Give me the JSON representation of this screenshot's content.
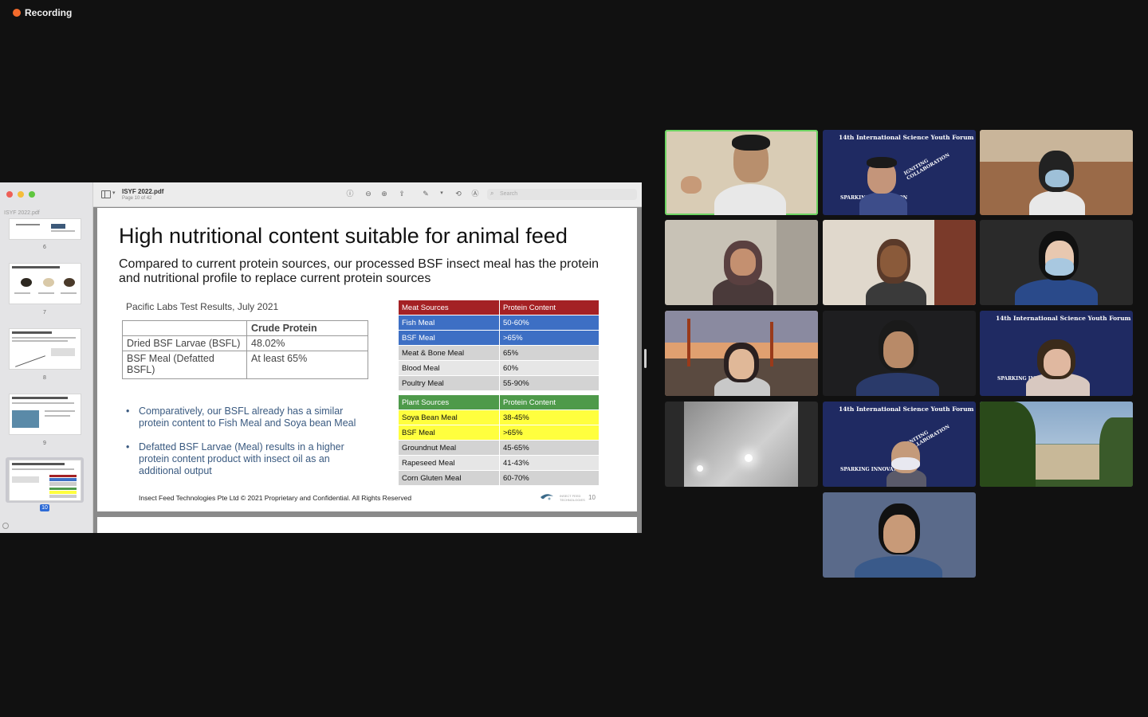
{
  "recording": {
    "label": "Recording"
  },
  "viewer": {
    "sidebar_title": "ISYF 2022.pdf",
    "document_name": "ISYF 2022.pdf",
    "page_indicator": "Page 10 of 42",
    "search_placeholder": "Search",
    "thumbnails": [
      {
        "number": "6",
        "title": ""
      },
      {
        "number": "7",
        "title": "Products and potential applications"
      },
      {
        "number": "8",
        "title": "Market analysis: The timing is right"
      },
      {
        "number": "9",
        "title": "Huge market potential for insect protein in the animal agriculture industry"
      },
      {
        "number": "10",
        "title": "High nutritional content suitable for animal feed",
        "selected": true
      }
    ]
  },
  "slide": {
    "title": "High nutritional content suitable for animal feed",
    "subtitle": "Compared to current protein sources, our processed BSF insect meal has the protein and nutritional profile to replace current protein sources",
    "test_caption": "Pacific Labs Test Results, July 2021",
    "crude_table": {
      "header": [
        "",
        "Crude Protein"
      ],
      "rows": [
        [
          "Dried BSF Larvae (BSFL)",
          "48.02%"
        ],
        [
          "BSF Meal (Defatted BSFL)",
          "At least 65%"
        ]
      ]
    },
    "bullets": [
      "Comparatively, our BSFL already has a similar protein content to Fish Meal and Soya bean Meal",
      "Defatted BSF Larvae (Meal) results in a higher protein content product with insect oil as an additional output"
    ],
    "meat_table": {
      "header": [
        "Meat Sources",
        "Protein Content"
      ],
      "rows": [
        [
          "Fish Meal",
          "50-60%"
        ],
        [
          "BSF Meal",
          ">65%"
        ],
        [
          "Meat & Bone Meal",
          "65%"
        ],
        [
          "Blood Meal",
          "60%"
        ],
        [
          "Poultry Meal",
          "55-90%"
        ]
      ]
    },
    "plant_table": {
      "header": [
        "Plant Sources",
        "Protein Content"
      ],
      "rows": [
        [
          "Soya Bean Meal",
          "38-45%"
        ],
        [
          "BSF Meal",
          ">65%"
        ],
        [
          "Groundnut Meal",
          "45-65%"
        ],
        [
          "Rapeseed Meal",
          "41-43%"
        ],
        [
          "Corn Gluten Meal",
          "60-70%"
        ]
      ]
    },
    "footer": "Insect Feed Technologies Pte Ltd © 2021 Proprietary and Confidential. All Rights Reserved",
    "logo_text": "INSECT FEED TECHNOLOGIES",
    "page_number": "10"
  },
  "participants": {
    "banner_title": "14th International Science Youth Forum",
    "banner_words": [
      "IGNITING COLLABORATION",
      "SPARKING INNOVATION"
    ]
  },
  "colors": {
    "meat_header": "#a42124",
    "plant_header": "#4e9a4a",
    "highlight_blue": "#3d6fc4",
    "highlight_yellow": "#ffff3e",
    "active_speaker": "#6fd563",
    "recording_dot": "#f36b2c"
  }
}
